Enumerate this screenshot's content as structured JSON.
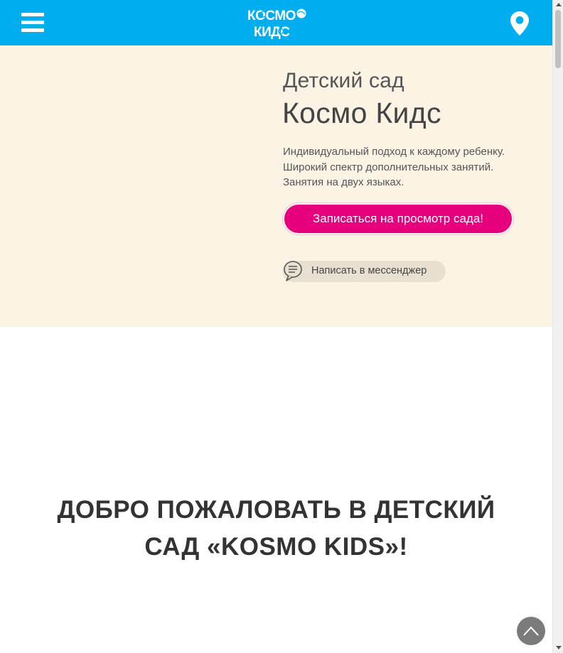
{
  "header": {
    "logo_text_line1": "КОСМО",
    "logo_text_line2": "КИДС",
    "menu_icon": "hamburger-menu-icon",
    "location_icon": "map-pin-icon",
    "background_color": "#00aeef"
  },
  "hero": {
    "subtitle": "Детский сад",
    "title": "Космо Кидс",
    "description": [
      "Индивидуальный подход к каждому ребенку.",
      "Широкий спектр дополнительных занятий.",
      "Занятия на двух языках."
    ],
    "cta_label": "Записаться на просмотр сада!",
    "messenger_label": "Написать в мессенджер",
    "messenger_icon": "chat-bubble-icon",
    "background_color": "#fbf4e5",
    "cta_color": "#e6007e"
  },
  "welcome": {
    "line1": "ДОБРО ПОЖАЛОВАТЬ В ДЕТСКИЙ",
    "line2": "САД «KOSMO KIDS»!"
  },
  "scroll_top_icon": "chevron-up-icon"
}
